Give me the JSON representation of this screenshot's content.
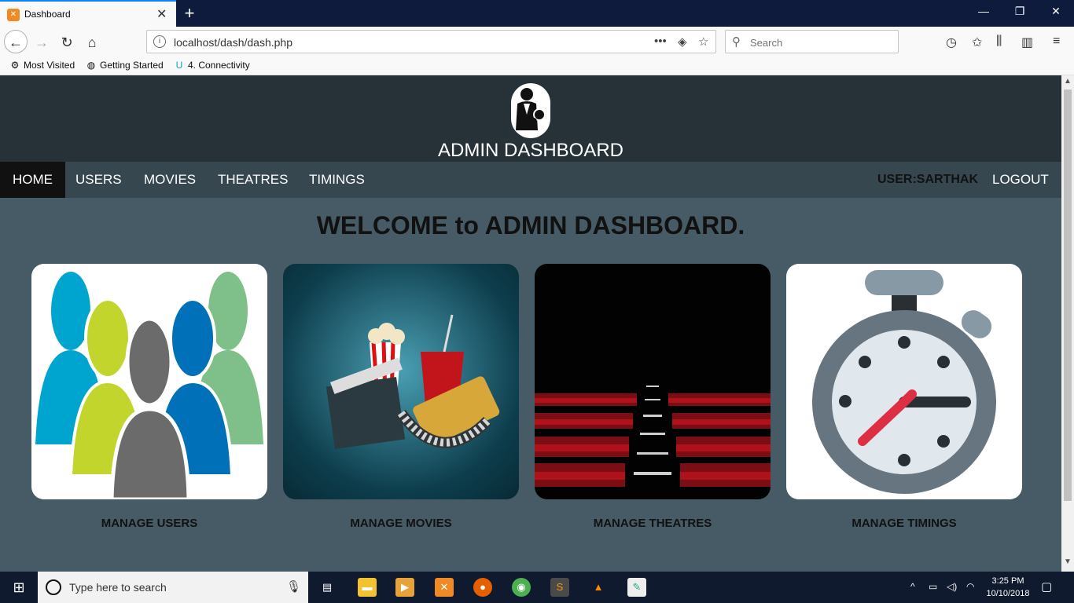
{
  "browser": {
    "tab_title": "Dashboard",
    "url": "localhost/dash/dash.php",
    "search_placeholder": "Search",
    "bookmarks": [
      "Most Visited",
      "Getting Started",
      "4. Connectivity"
    ]
  },
  "header": {
    "title": "ADMIN DASHBOARD"
  },
  "menu": {
    "items": [
      "HOME",
      "USERS",
      "MOVIES",
      "THEATRES",
      "TIMINGS"
    ],
    "user": "USER:SARTHAK",
    "logout": "LOGOUT"
  },
  "main": {
    "welcome": "WELCOME to ADMIN DASHBOARD.",
    "cards": [
      "MANAGE USERS",
      "MANAGE MOVIES",
      "MANAGE THEATRES",
      "MANAGE TIMINGS"
    ]
  },
  "taskbar": {
    "search_placeholder": "Type here to search",
    "time": "3:25 PM",
    "date": "10/10/2018"
  }
}
